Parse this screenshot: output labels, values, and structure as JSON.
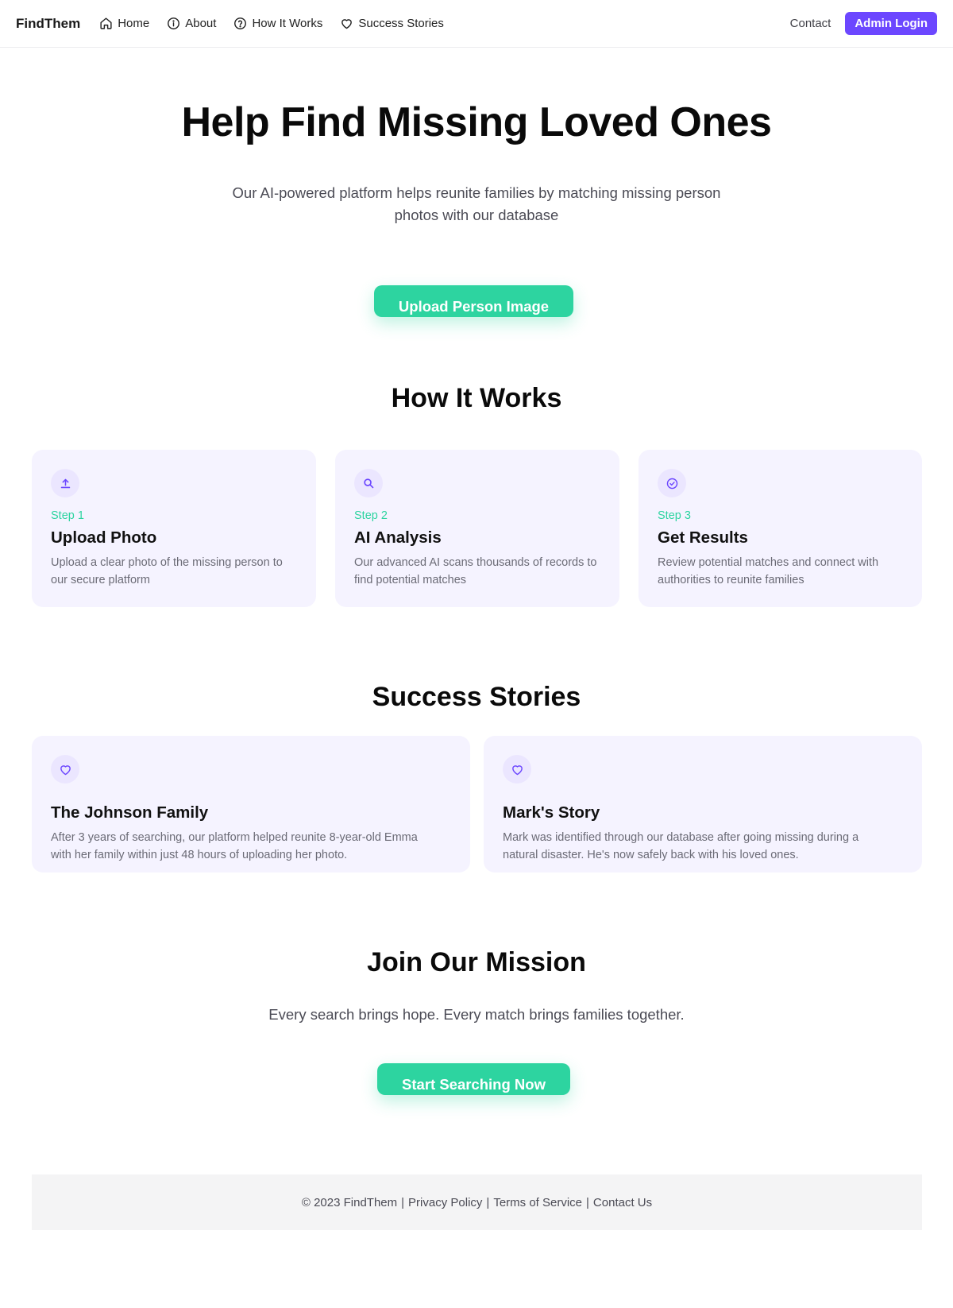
{
  "nav": {
    "brand": "FindThem",
    "links": [
      {
        "label": "Home",
        "icon": "home-icon"
      },
      {
        "label": "About",
        "icon": "info-icon"
      },
      {
        "label": "How It Works",
        "icon": "help-circle-icon"
      },
      {
        "label": "Success Stories",
        "icon": "heart-icon"
      }
    ],
    "contact": "Contact",
    "admin_login": "Admin Login"
  },
  "hero": {
    "title": "Help Find Missing Loved Ones",
    "subtitle": "Our AI-powered platform helps reunite families by matching missing person photos with our database",
    "cta": "Upload Person Image"
  },
  "how_it_works": {
    "title": "How It Works",
    "steps": [
      {
        "step": "Step 1",
        "title": "Upload Photo",
        "description": "Upload a clear photo of the missing person to our secure platform",
        "icon": "upload-icon"
      },
      {
        "step": "Step 2",
        "title": "AI Analysis",
        "description": "Our advanced AI scans thousands of records to find potential matches",
        "icon": "search-icon"
      },
      {
        "step": "Step 3",
        "title": "Get Results",
        "description": "Review potential matches and connect with authorities to reunite families",
        "icon": "check-circle-icon"
      }
    ]
  },
  "success_stories": {
    "title": "Success Stories",
    "stories": [
      {
        "title": "The Johnson Family",
        "description": "After 3 years of searching, our platform helped reunite 8-year-old Emma with her family within just 48 hours of uploading her photo.",
        "icon": "heart-icon"
      },
      {
        "title": "Mark's Story",
        "description": "Mark was identified through our database after going missing during a natural disaster. He's now safely back with his loved ones.",
        "icon": "heart-icon"
      }
    ]
  },
  "join": {
    "title": "Join Our Mission",
    "subtitle": "Every search brings hope. Every match brings families together.",
    "cta": "Start Searching Now"
  },
  "footer": {
    "copyright": "© 2023 FindThem",
    "separator": "|",
    "links": [
      "Privacy Policy",
      "Terms of Service",
      "Contact Us"
    ]
  },
  "colors": {
    "accent_purple": "#6c47ff",
    "accent_green": "#2dd4a0",
    "card_bg": "#f5f3ff",
    "footer_bg": "#f4f4f5"
  }
}
